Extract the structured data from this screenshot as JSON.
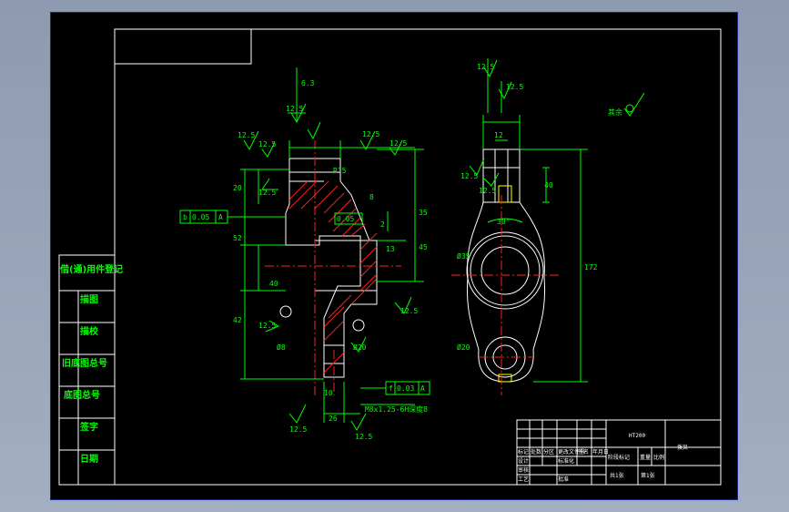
{
  "side_table": {
    "header": "借(通)用件登记",
    "rows": [
      "描图",
      "描校",
      "旧底图总号",
      "底图总号",
      "签字",
      "日期"
    ]
  },
  "left_view": {
    "roughness": [
      "12.5",
      "12.5",
      "12.5",
      "12.5",
      "12.5",
      "12.5",
      "12.5",
      "12.5",
      "12.5",
      "12.5",
      "6.3"
    ],
    "dims": [
      "20",
      "52",
      "42",
      "13",
      "35",
      "45",
      "26",
      "40",
      "8",
      "10",
      "2",
      "R15",
      "Ø8",
      "Ø20"
    ],
    "gdt1": [
      "b",
      "0.05",
      "A"
    ],
    "gdt2": [
      "f",
      "0.03",
      "A"
    ],
    "tolerance": "0.05",
    "thread": "M8x1.25-6H深度8"
  },
  "right_view": {
    "roughness": [
      "12.5",
      "12.5",
      "12.5",
      "12.5"
    ],
    "dims": [
      "40",
      "30°",
      "12",
      "172",
      "Ø35",
      "Ø20"
    ],
    "note": "其余"
  },
  "title_block": {
    "material": "HT200",
    "part_name": "拨叉",
    "cells": [
      "标记",
      "处数",
      "分区",
      "更改文件号",
      "签名",
      "年月日",
      "设计",
      "标准化",
      "阶段标记",
      "重量",
      "比例",
      "审核",
      "工艺",
      "批准",
      "共1张",
      "第1张"
    ]
  }
}
